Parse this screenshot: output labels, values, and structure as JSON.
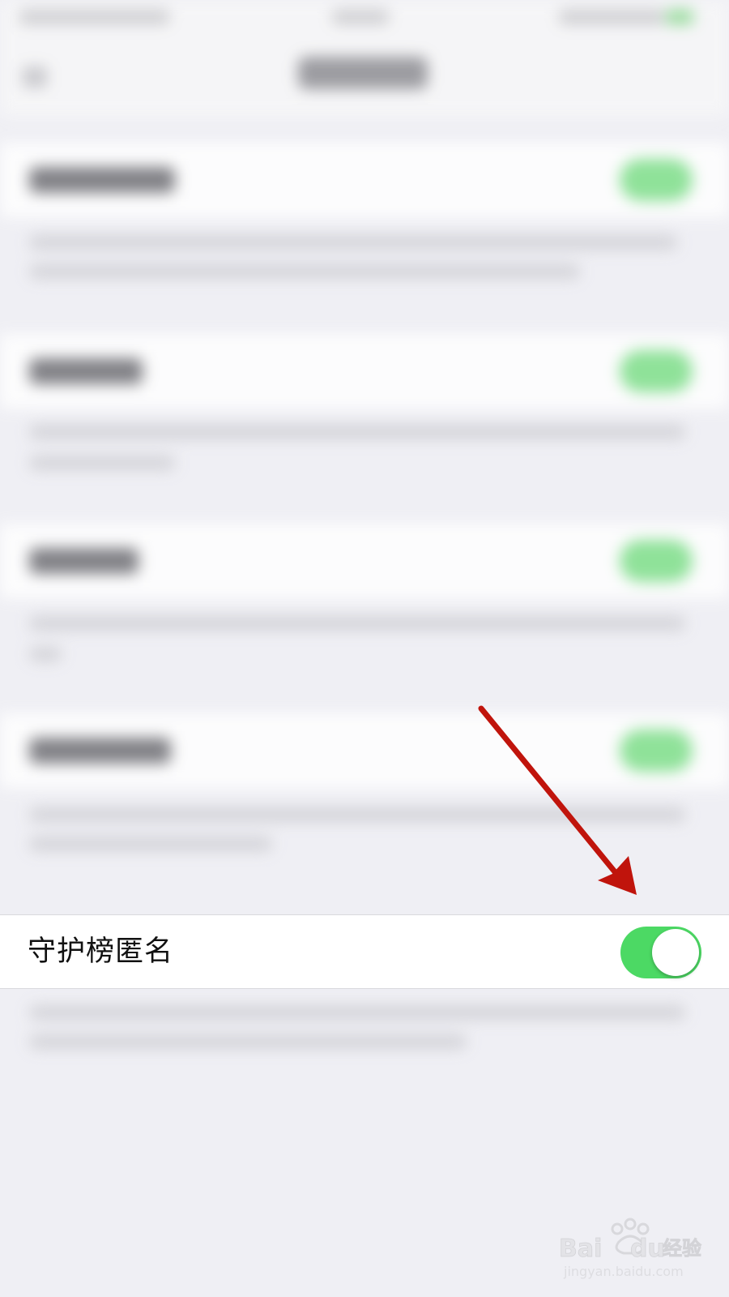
{
  "setting": {
    "label": "守护榜匿名",
    "enabled": true
  },
  "colors": {
    "toggle_on": "#4cd964",
    "background": "#efeff4",
    "arrow": "#c0140c"
  },
  "watermark": {
    "brand": "Bai du 经验",
    "url": "jingyan.baidu.com"
  }
}
